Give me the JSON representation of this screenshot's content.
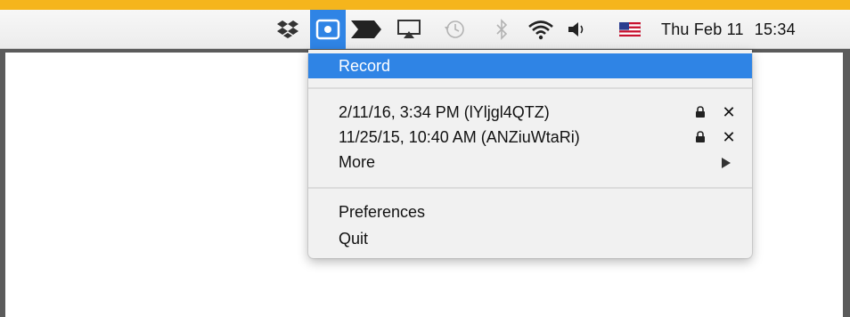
{
  "menubar": {
    "clock": {
      "date": "Thu Feb 11",
      "time": "15:34"
    },
    "icons": [
      "dropbox-icon",
      "screen-recorder-icon",
      "forward-arrows-icon",
      "airplay-icon",
      "time-machine-icon",
      "bluetooth-icon",
      "wifi-icon",
      "volume-icon",
      "us-flag-icon"
    ],
    "colors": {
      "highlight": "#2f84e5",
      "frame": "#f5b51c"
    }
  },
  "menu": {
    "record_label": "Record",
    "recordings": [
      {
        "label": "2/11/16, 3:34 PM (lYljgl4QTZ)",
        "close": "✕"
      },
      {
        "label": "11/25/15, 10:40 AM (ANZiuWtaRi)",
        "close": "✕"
      }
    ],
    "more_label": "More",
    "preferences_label": "Preferences",
    "quit_label": "Quit"
  }
}
